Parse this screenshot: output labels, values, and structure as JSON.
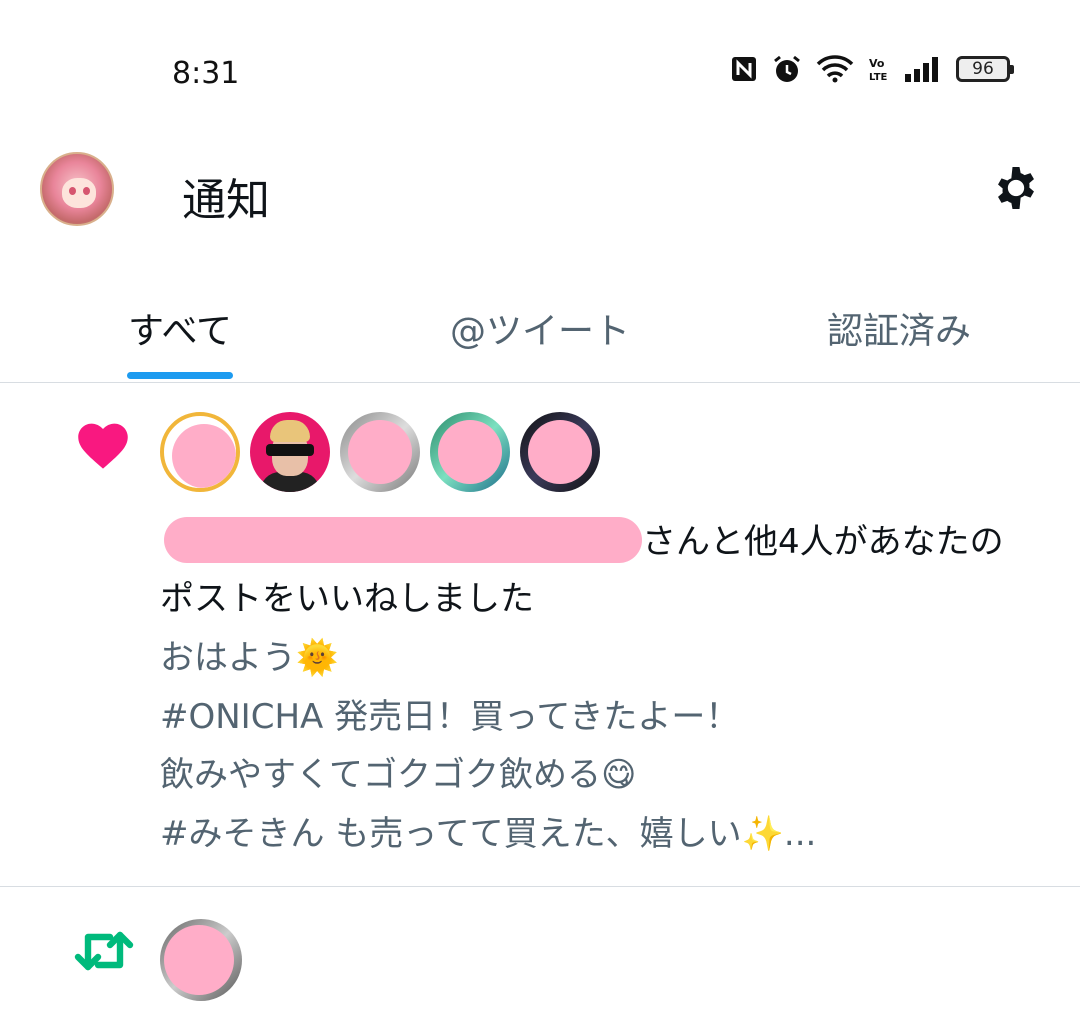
{
  "status_bar": {
    "time": "8:31",
    "battery": "96",
    "icons": [
      "nfc-icon",
      "alarm-icon",
      "wifi-icon",
      "volte-icon",
      "signal-icon",
      "battery-icon"
    ]
  },
  "header": {
    "title": "通知"
  },
  "tabs": [
    {
      "label": "すべて",
      "active": true
    },
    {
      "label": "@ツイート",
      "active": false
    },
    {
      "label": "認証済み",
      "active": false
    }
  ],
  "notifications": [
    {
      "type": "like",
      "icon": "heart-icon",
      "icon_color": "#f91880",
      "text_suffix": "さんと他4人があなたの",
      "text_line2": "ポストをいいねしました",
      "preview_lines": [
        "おはよう🌞",
        "#ONICHA 発売日！買ってきたよー！",
        "飲みやすくてゴクゴク飲める😋",
        "#みそきん も売ってて買えた、嬉しい✨..."
      ]
    },
    {
      "type": "repost",
      "icon": "repost-icon",
      "icon_color": "#00ba7c"
    }
  ],
  "colors": {
    "accent": "#1d9bf0",
    "redaction": "#ffadc8",
    "secondary_text": "#536471"
  }
}
